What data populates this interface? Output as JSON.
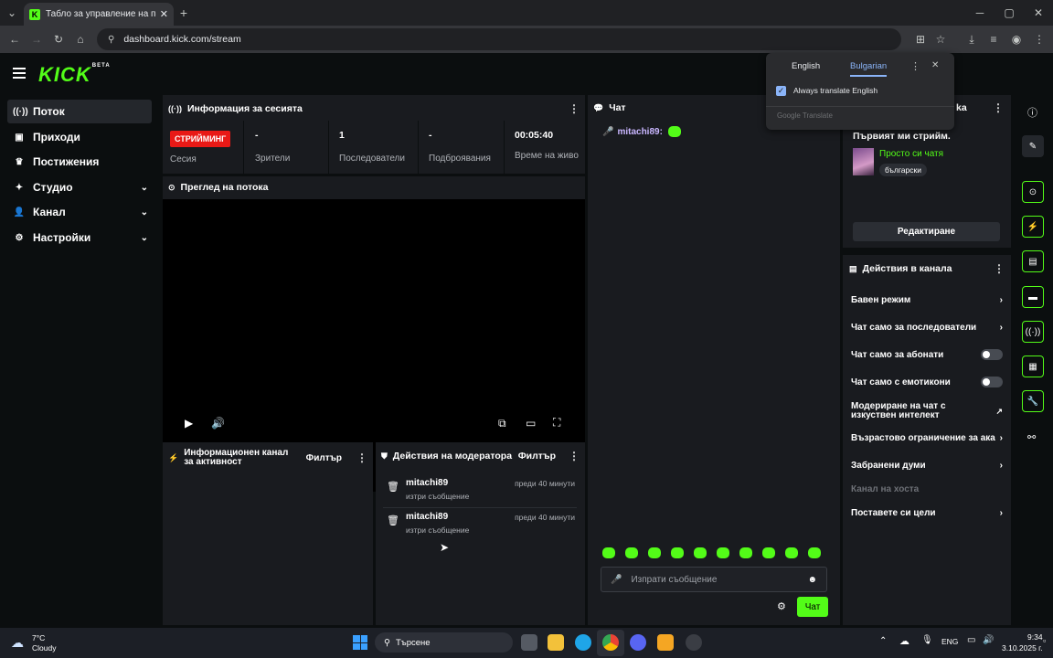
{
  "browser": {
    "tab_title": "Табло за управление на поток",
    "tab_close": "✕",
    "new_tab": "+",
    "url": "dashboard.kick.com/stream",
    "window_minimize": "─",
    "window_maximize": "▢",
    "window_close": "✕"
  },
  "translate_popup": {
    "lang_source": "English",
    "lang_target": "Bulgarian",
    "checkbox_label": "Always translate English",
    "footer": "Google Translate",
    "close": "✕"
  },
  "logo": {
    "text": "KICK",
    "badge": "BETA"
  },
  "sidebar": {
    "items": [
      {
        "label": "Поток",
        "icon": "stream-icon",
        "glyph": "((·))"
      },
      {
        "label": "Приходи",
        "icon": "revenue-icon",
        "glyph": "▣"
      },
      {
        "label": "Постижения",
        "icon": "trophy-icon",
        "glyph": "♛"
      },
      {
        "label": "Студио",
        "icon": "studio-icon",
        "glyph": "✦"
      },
      {
        "label": "Канал",
        "icon": "channel-icon",
        "glyph": "👤"
      },
      {
        "label": "Настройки",
        "icon": "settings-icon",
        "glyph": "⚙"
      }
    ]
  },
  "session": {
    "title": "Информация за сесията",
    "live_badge": "СТРИЙМИНГ",
    "session_label": "Сесия",
    "stats": [
      {
        "value": "-",
        "label": "Зрители"
      },
      {
        "value": "1",
        "label": "Последователи"
      },
      {
        "value": "-",
        "label": "Подбрoявания"
      },
      {
        "value": "00:05:40",
        "label": "Време на живо"
      }
    ]
  },
  "preview": {
    "title": "Преглед на потока"
  },
  "activity": {
    "title": "Информационен канал за активност",
    "filter": "Филтър"
  },
  "mod_actions": {
    "title": "Действия на модератора",
    "filter": "Филтър",
    "items": [
      {
        "user": "mitachi89",
        "action": "изтри съобщение",
        "time": "преди 40 минути"
      },
      {
        "user": "mitachi89",
        "action": "изтри съобщение",
        "time": "преди 40 минути"
      }
    ]
  },
  "chat": {
    "title": "Чат",
    "message_user": "mitachi89:",
    "input_placeholder": "Изпрати съобщение",
    "send_button": "Чат"
  },
  "stream_info": {
    "title_suffix": "ka",
    "stream_title": "Първият ми стрийм.",
    "category": "Просто си чатя",
    "language": "български",
    "edit_button": "Редактиране"
  },
  "channel_actions": {
    "title": "Действия в канала",
    "items": [
      {
        "label": "Бавен режим",
        "control": "chevron"
      },
      {
        "label": "Чат само за последователи",
        "control": "chevron"
      },
      {
        "label": "Чат само за абонати",
        "control": "toggle"
      },
      {
        "label": "Чат само с емотикони",
        "control": "toggle"
      },
      {
        "label": "Модериране на чат с изкуствен интелект",
        "control": "external"
      },
      {
        "label": "Възрастово ограничение за ака",
        "control": "chevron"
      },
      {
        "label": "Забранени думи",
        "control": "chevron"
      },
      {
        "label": "Канал на хоста",
        "control": "none"
      },
      {
        "label": "Поставете си цели",
        "control": "chevron"
      }
    ]
  },
  "taskbar": {
    "temperature": "7°C",
    "weather": "Cloudy",
    "search_placeholder": "Търсене",
    "language": "ENG",
    "time": "9:34",
    "date": "3.10.2025 г."
  },
  "colors": {
    "accent": "#53fc18",
    "live": "#e91916",
    "panel": "#191b1f",
    "background": "#0b0e0f"
  }
}
